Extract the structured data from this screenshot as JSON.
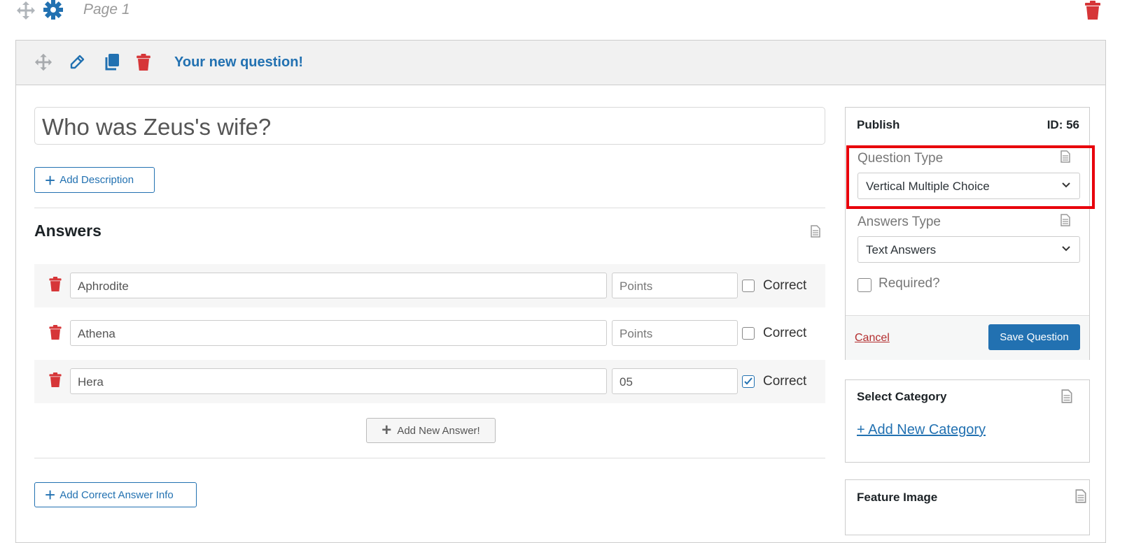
{
  "page": {
    "title": "Page 1"
  },
  "question": {
    "header_title": "Your new question!",
    "title_value": "Who was Zeus's wife?",
    "add_description_label": "Add Description",
    "answers_heading": "Answers",
    "answers": [
      {
        "text": "Aphrodite",
        "points": "",
        "points_placeholder": "Points",
        "correct_label": "Correct",
        "correct": false
      },
      {
        "text": "Athena",
        "points": "",
        "points_placeholder": "Points",
        "correct_label": "Correct",
        "correct": false
      },
      {
        "text": "Hera",
        "points": "05",
        "points_placeholder": "Points",
        "correct_label": "Correct",
        "correct": true
      }
    ],
    "add_answer_label": "Add New Answer!",
    "add_correct_info_label": "Add Correct Answer Info"
  },
  "publish": {
    "title": "Publish",
    "id_label": "ID: 56",
    "question_type_label": "Question Type",
    "question_type_value": "Vertical Multiple Choice",
    "answers_type_label": "Answers Type",
    "answers_type_value": "Text Answers",
    "required_label": "Required?",
    "required": false,
    "cancel_label": "Cancel",
    "save_label": "Save Question"
  },
  "category": {
    "title": "Select Category",
    "add_label": "+ Add New Category"
  },
  "feature_image": {
    "title": "Feature Image"
  },
  "colors": {
    "accent": "#2271b1",
    "danger": "#d63638",
    "highlight": "#e8000b"
  },
  "icons": [
    "move-icon",
    "gear-icon",
    "trash-icon",
    "pencil-icon",
    "copy-icon",
    "doc-icon",
    "chevron-down-icon",
    "plus-icon"
  ]
}
